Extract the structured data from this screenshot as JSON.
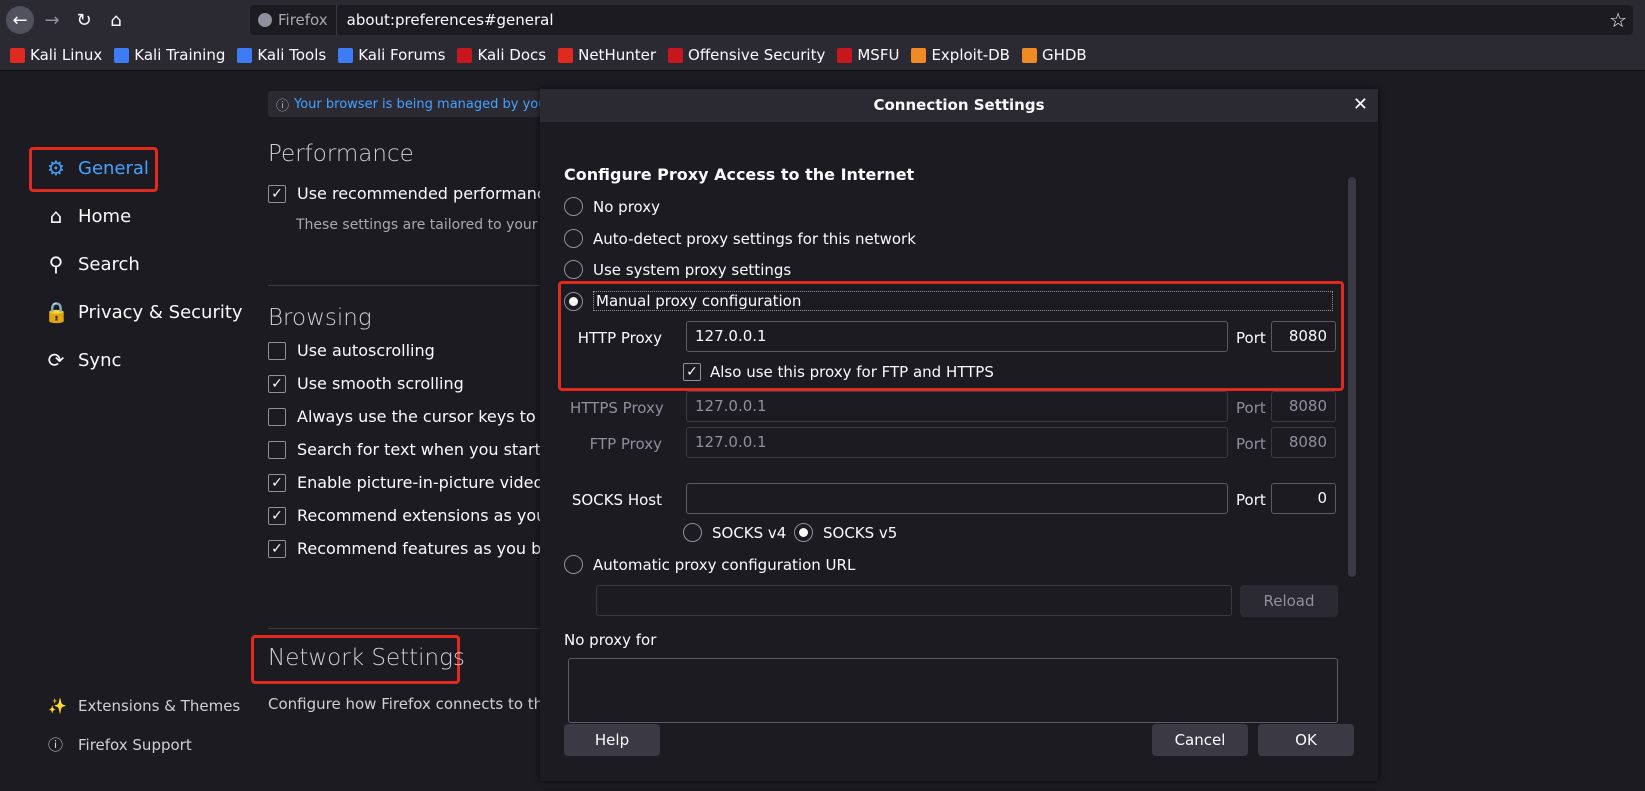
{
  "toolbar": {
    "identity_label": "Firefox",
    "url": "about:preferences#general"
  },
  "bookmarks": [
    {
      "label": "Kali Linux",
      "color": "#e0291f"
    },
    {
      "label": "Kali Training",
      "color": "#3d7cf4"
    },
    {
      "label": "Kali Tools",
      "color": "#3d7cf4"
    },
    {
      "label": "Kali Forums",
      "color": "#3d7cf4"
    },
    {
      "label": "Kali Docs",
      "color": "#c8161d"
    },
    {
      "label": "NetHunter",
      "color": "#e0291f"
    },
    {
      "label": "Offensive Security",
      "color": "#c8161d"
    },
    {
      "label": "MSFU",
      "color": "#c8161d"
    },
    {
      "label": "Exploit-DB",
      "color": "#f08a24"
    },
    {
      "label": "GHDB",
      "color": "#f08a24"
    }
  ],
  "sidebar": {
    "items": [
      {
        "label": "General",
        "icon": "gear-icon"
      },
      {
        "label": "Home",
        "icon": "home-icon"
      },
      {
        "label": "Search",
        "icon": "search-icon"
      },
      {
        "label": "Privacy & Security",
        "icon": "lock-icon"
      },
      {
        "label": "Sync",
        "icon": "sync-icon"
      }
    ],
    "extensions_label": "Extensions & Themes",
    "support_label": "Firefox Support"
  },
  "main": {
    "managed_notice": "Your browser is being managed by your",
    "performance_title": "Performance",
    "performance_option": "Use recommended performance s",
    "performance_sub": "These settings are tailored to your co",
    "browsing_title": "Browsing",
    "browsing_options": [
      {
        "label": "Use autoscrolling",
        "checked": false
      },
      {
        "label": "Use smooth scrolling",
        "checked": true
      },
      {
        "label": "Always use the cursor keys to navi",
        "checked": false
      },
      {
        "label": "Search for text when you start typ",
        "checked": false
      },
      {
        "label": "Enable picture-in-picture video co",
        "checked": true
      },
      {
        "label": "Recommend extensions as you bro",
        "checked": true
      },
      {
        "label": "Recommend features as you brow",
        "checked": true
      }
    ],
    "network_title": "Network Settings",
    "network_sub": "Configure how Firefox connects to the"
  },
  "dialog": {
    "title": "Connection Settings",
    "heading": "Configure Proxy Access to the Internet",
    "options": {
      "no_proxy": "No proxy",
      "auto_detect": "Auto-detect proxy settings for this network",
      "system": "Use system proxy settings",
      "manual": "Manual proxy configuration",
      "auto_url": "Automatic proxy configuration URL"
    },
    "http_label": "HTTP Proxy",
    "http_value": "127.0.0.1",
    "port_label": "Port",
    "http_port": "8080",
    "also_use": "Also use this proxy for FTP and HTTPS",
    "https_label": "HTTPS Proxy",
    "https_value": "127.0.0.1",
    "https_port": "8080",
    "ftp_label": "FTP Proxy",
    "ftp_value": "127.0.0.1",
    "ftp_port": "8080",
    "socks_label": "SOCKS Host",
    "socks_value": "",
    "socks_port": "0",
    "socks_v4": "SOCKS v4",
    "socks_v5": "SOCKS v5",
    "reload": "Reload",
    "no_proxy_for": "No proxy for",
    "help": "Help",
    "cancel": "Cancel",
    "ok": "OK"
  }
}
